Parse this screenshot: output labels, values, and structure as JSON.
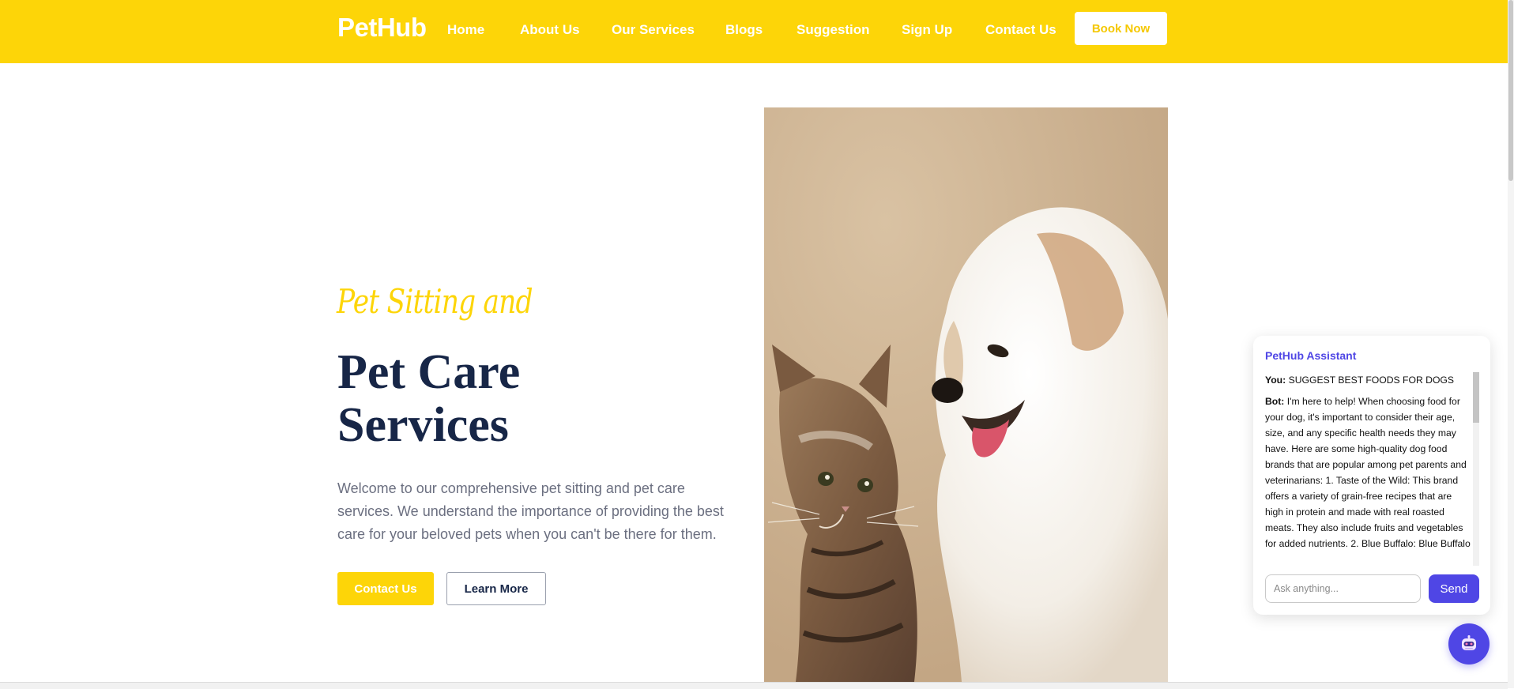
{
  "header": {
    "logo": "PetHub",
    "nav": [
      "Home",
      "About Us",
      "Our Services",
      "Blogs",
      "Suggestion",
      "Sign Up",
      "Contact Us"
    ],
    "cta": "Book Now"
  },
  "hero": {
    "script_title": "Pet Sitting and",
    "title": "Pet Care Services",
    "description": "Welcome to our comprehensive pet sitting and pet care services. We understand the importance of providing the best care for your beloved pets when you can't be there for them.",
    "primary_button": "Contact Us",
    "secondary_button": "Learn More",
    "image_subject": "kitten and puppy"
  },
  "chat": {
    "title": "PetHub Assistant",
    "messages": [
      {
        "sender": "You:",
        "text": "SUGGEST BEST FOODS FOR DOGS"
      },
      {
        "sender": "Bot:",
        "text": "I'm here to help! When choosing food for your dog, it's important to consider their age, size, and any specific health needs they may have. Here are some high-quality dog food brands that are popular among pet parents and veterinarians: 1. Taste of the Wild: This brand offers a variety of grain-free recipes that are high in protein and made with real roasted meats. They also include fruits and vegetables for added nutrients. 2. Blue Buffalo: Blue Buffalo"
      }
    ],
    "input_placeholder": "Ask anything...",
    "send_label": "Send",
    "fab_icon": "robot-icon"
  },
  "colors": {
    "brand_yellow": "#fdd508",
    "navy": "#172647",
    "chat_accent": "#4f46e5"
  }
}
